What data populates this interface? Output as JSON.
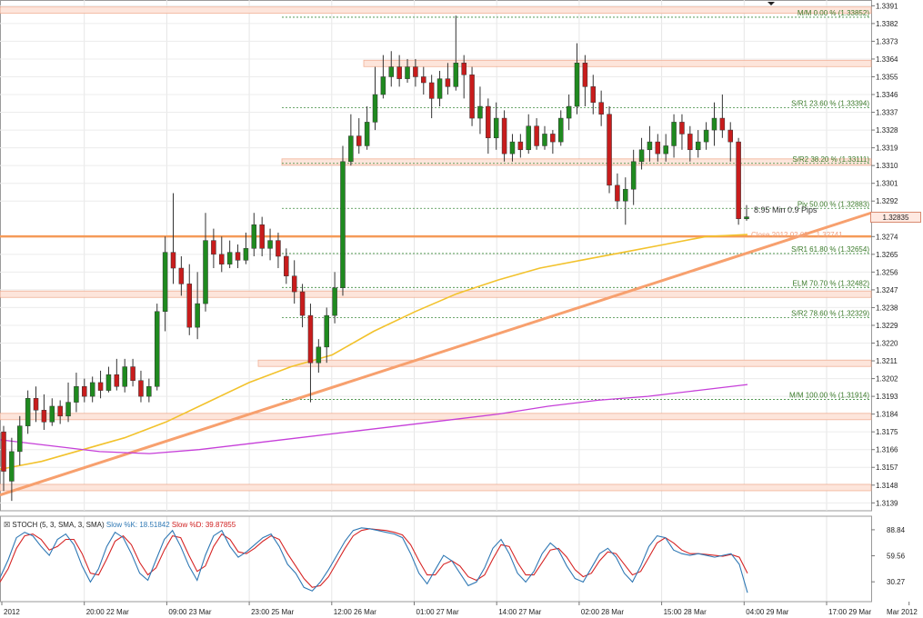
{
  "chart_data": {
    "type": "candlestick",
    "instrument_y_axis": {
      "ticks": [
        1.3391,
        1.3382,
        1.3373,
        1.3364,
        1.3355,
        1.3346,
        1.3337,
        1.3328,
        1.3319,
        1.331,
        1.3301,
        1.3292,
        1.3274,
        1.3265,
        1.3256,
        1.3247,
        1.3238,
        1.3229,
        1.322,
        1.3211,
        1.3202,
        1.3193,
        1.3184,
        1.3175,
        1.3166,
        1.3157,
        1.3148,
        1.3139
      ],
      "ylim": [
        1.3135,
        1.3393
      ]
    },
    "x_tick_labels": [
      "2012",
      "20:00 22 Mar",
      "09:00 23 Mar",
      "23:00 25 Mar",
      "12:00 26 Mar",
      "01:00 27 Mar",
      "14:00 27 Mar",
      "02:00 28 Mar",
      "15:00 28 Mar",
      "04:00 29 Mar",
      "17:00 29 Mar",
      "Mar 2012"
    ],
    "current_price": "1.32835",
    "measurement_label": "8.95 Min 0.9 Pips",
    "close_label": "Close 2012.02.09 .. 1.32741",
    "fib_levels": [
      {
        "label": "M/M 0.00 % (1.33852)",
        "price": 1.33852
      },
      {
        "label": "S/R1 23.60 % (1.33394)",
        "price": 1.33394
      },
      {
        "label": "S/R2 38.20 % (1.33111)",
        "price": 1.33111
      },
      {
        "label": "Piv 50.00 % (1.32883)",
        "price": 1.32883
      },
      {
        "label": "S/R1 61.80 % (1.32654)",
        "price": 1.32654
      },
      {
        "label": "ELM 70.70 % (1.32482)",
        "price": 1.32482
      },
      {
        "label": "S/R2 78.60 % (1.32329)",
        "price": 1.32329
      },
      {
        "label": "M/M 100.00 % (1.31914)",
        "price": 1.31914
      }
    ],
    "zones": [
      1.3389,
      1.3362,
      1.3312,
      1.3245,
      1.321,
      1.3183,
      1.3147
    ],
    "close_line": 1.32741,
    "trendline": {
      "start": 1.3143,
      "end": 1.3286
    },
    "sma_yellow": [
      1.3156,
      1.316,
      1.3166,
      1.3172,
      1.318,
      1.319,
      1.32,
      1.3208,
      1.3214,
      1.3226,
      1.3236,
      1.3245,
      1.3252,
      1.3258,
      1.3262,
      1.3266,
      1.327,
      1.3274,
      1.3275
    ],
    "sma_magenta": [
      1.3171,
      1.3168,
      1.3165,
      1.3164,
      1.3166,
      1.3169,
      1.3172,
      1.3175,
      1.3178,
      1.3181,
      1.3184,
      1.3188,
      1.3191,
      1.3193,
      1.3196,
      1.3199
    ],
    "candles": [
      [
        1.3175,
        1.3155,
        1.3178,
        1.3145
      ],
      [
        1.315,
        1.3165,
        1.3172,
        1.314
      ],
      [
        1.3165,
        1.3178,
        1.3183,
        1.3158
      ],
      [
        1.3178,
        1.3192,
        1.3196,
        1.3174
      ],
      [
        1.3192,
        1.3186,
        1.3198,
        1.318
      ],
      [
        1.3186,
        1.318,
        1.3194,
        1.3176
      ],
      [
        1.318,
        1.3188,
        1.3192,
        1.3178
      ],
      [
        1.3188,
        1.3183,
        1.3191,
        1.3179
      ],
      [
        1.3183,
        1.319,
        1.32,
        1.318
      ],
      [
        1.319,
        1.3198,
        1.3205,
        1.3185
      ],
      [
        1.3198,
        1.3193,
        1.3202,
        1.319
      ],
      [
        1.3193,
        1.32,
        1.3203,
        1.319
      ],
      [
        1.32,
        1.3196,
        1.3206,
        1.3192
      ],
      [
        1.3196,
        1.3204,
        1.3208,
        1.3195
      ],
      [
        1.3204,
        1.3198,
        1.3212,
        1.3196
      ],
      [
        1.3198,
        1.3208,
        1.3212,
        1.3195
      ],
      [
        1.3208,
        1.3201,
        1.3212,
        1.3198
      ],
      [
        1.3201,
        1.3193,
        1.3206,
        1.319
      ],
      [
        1.3193,
        1.3198,
        1.3202,
        1.319
      ],
      [
        1.3198,
        1.3236,
        1.324,
        1.3196
      ],
      [
        1.3236,
        1.3266,
        1.3274,
        1.3226
      ],
      [
        1.3266,
        1.3258,
        1.3296,
        1.325
      ],
      [
        1.3258,
        1.325,
        1.3264,
        1.3244
      ],
      [
        1.325,
        1.3228,
        1.326,
        1.3224
      ],
      [
        1.3228,
        1.324,
        1.3256,
        1.3222
      ],
      [
        1.324,
        1.3272,
        1.3286,
        1.3236
      ],
      [
        1.3272,
        1.3265,
        1.3278,
        1.3258
      ],
      [
        1.3265,
        1.326,
        1.3274,
        1.3256
      ],
      [
        1.326,
        1.3266,
        1.3272,
        1.3258
      ],
      [
        1.3266,
        1.3262,
        1.327,
        1.3258
      ],
      [
        1.3262,
        1.3268,
        1.3276,
        1.326
      ],
      [
        1.3268,
        1.328,
        1.3286,
        1.3264
      ],
      [
        1.328,
        1.3268,
        1.3284,
        1.3264
      ],
      [
        1.3268,
        1.3272,
        1.3278,
        1.3262
      ],
      [
        1.3272,
        1.3264,
        1.3276,
        1.3258
      ],
      [
        1.3264,
        1.3254,
        1.3268,
        1.325
      ],
      [
        1.3254,
        1.3246,
        1.3262,
        1.324
      ],
      [
        1.3246,
        1.3234,
        1.325,
        1.3228
      ],
      [
        1.3234,
        1.321,
        1.324,
        1.319
      ],
      [
        1.321,
        1.3218,
        1.3222,
        1.3205
      ],
      [
        1.3218,
        1.3234,
        1.3238,
        1.321
      ],
      [
        1.3234,
        1.3248,
        1.3256,
        1.323
      ],
      [
        1.3248,
        1.3312,
        1.332,
        1.3244
      ],
      [
        1.3312,
        1.3325,
        1.3336,
        1.331
      ],
      [
        1.3325,
        1.332,
        1.3334,
        1.3316
      ],
      [
        1.332,
        1.3332,
        1.334,
        1.3318
      ],
      [
        1.3332,
        1.3346,
        1.336,
        1.3328
      ],
      [
        1.3346,
        1.3355,
        1.3366,
        1.3344
      ],
      [
        1.3355,
        1.336,
        1.3368,
        1.335
      ],
      [
        1.336,
        1.3354,
        1.3366,
        1.335
      ],
      [
        1.3354,
        1.336,
        1.3364,
        1.3352
      ],
      [
        1.336,
        1.3355,
        1.3364,
        1.335
      ],
      [
        1.3355,
        1.3352,
        1.336,
        1.3346
      ],
      [
        1.3352,
        1.3344,
        1.3356,
        1.3334
      ],
      [
        1.3344,
        1.3354,
        1.3358,
        1.334
      ],
      [
        1.3354,
        1.335,
        1.3362,
        1.3346
      ],
      [
        1.335,
        1.3362,
        1.3386,
        1.3348
      ],
      [
        1.3362,
        1.3356,
        1.3366,
        1.3344
      ],
      [
        1.3356,
        1.3334,
        1.336,
        1.333
      ],
      [
        1.3334,
        1.334,
        1.335,
        1.3326
      ],
      [
        1.334,
        1.3324,
        1.3344,
        1.3316
      ],
      [
        1.3324,
        1.3334,
        1.3342,
        1.3318
      ],
      [
        1.3334,
        1.3316,
        1.3338,
        1.3312
      ],
      [
        1.3316,
        1.3322,
        1.3326,
        1.3312
      ],
      [
        1.3322,
        1.3318,
        1.3326,
        1.3314
      ],
      [
        1.3318,
        1.333,
        1.3336,
        1.3316
      ],
      [
        1.333,
        1.332,
        1.3334,
        1.3318
      ],
      [
        1.332,
        1.3326,
        1.333,
        1.3318
      ],
      [
        1.3326,
        1.3322,
        1.3328,
        1.3316
      ],
      [
        1.3322,
        1.3334,
        1.3338,
        1.332
      ],
      [
        1.3334,
        1.334,
        1.3346,
        1.3328
      ],
      [
        1.334,
        1.3362,
        1.3372,
        1.3336
      ],
      [
        1.3362,
        1.335,
        1.3366,
        1.334
      ],
      [
        1.335,
        1.3342,
        1.3356,
        1.3336
      ],
      [
        1.3342,
        1.3336,
        1.3348,
        1.333
      ],
      [
        1.3336,
        1.33,
        1.334,
        1.3296
      ],
      [
        1.33,
        1.3292,
        1.3306,
        1.3288
      ],
      [
        1.3292,
        1.3298,
        1.3304,
        1.328
      ],
      [
        1.3298,
        1.3312,
        1.3318,
        1.329
      ],
      [
        1.3312,
        1.3318,
        1.3324,
        1.3308
      ],
      [
        1.3318,
        1.3322,
        1.333,
        1.3312
      ],
      [
        1.3322,
        1.3316,
        1.3326,
        1.3312
      ],
      [
        1.3316,
        1.332,
        1.3326,
        1.3312
      ],
      [
        1.332,
        1.3332,
        1.3336,
        1.3314
      ],
      [
        1.3332,
        1.3326,
        1.3336,
        1.3318
      ],
      [
        1.3326,
        1.3318,
        1.333,
        1.3312
      ],
      [
        1.3318,
        1.3322,
        1.3328,
        1.3314
      ],
      [
        1.3322,
        1.3328,
        1.3332,
        1.3318
      ],
      [
        1.3328,
        1.3334,
        1.3342,
        1.332
      ],
      [
        1.3334,
        1.3328,
        1.3346,
        1.3324
      ],
      [
        1.3328,
        1.3322,
        1.3332,
        1.3312
      ],
      [
        1.3322,
        1.3283,
        1.3324,
        1.328
      ],
      [
        1.3283,
        1.3284,
        1.329,
        1.3282
      ]
    ],
    "stochastic": {
      "title_prefix": "STOCH (5, 3, SMA, 3, SMA)",
      "k_label": "Slow %K: 18.51842",
      "d_label": "Slow %D: 39.87855",
      "ticks": [
        88.84,
        59.56,
        30.27
      ],
      "k_values": [
        35,
        55,
        80,
        86,
        82,
        70,
        60,
        78,
        84,
        72,
        48,
        30,
        45,
        70,
        86,
        80,
        62,
        40,
        32,
        55,
        78,
        88,
        70,
        48,
        32,
        60,
        82,
        88,
        70,
        58,
        64,
        72,
        80,
        84,
        70,
        50,
        40,
        24,
        20,
        30,
        44,
        60,
        76,
        88,
        91,
        90,
        88,
        86,
        84,
        80,
        62,
        40,
        28,
        44,
        60,
        54,
        40,
        26,
        30,
        46,
        68,
        78,
        62,
        40,
        30,
        42,
        62,
        74,
        66,
        48,
        34,
        30,
        46,
        62,
        68,
        58,
        40,
        30,
        48,
        70,
        82,
        80,
        66,
        62,
        60,
        62,
        60,
        58,
        60,
        62,
        50,
        18
      ],
      "d_values": [
        30,
        45,
        68,
        82,
        84,
        78,
        66,
        70,
        78,
        78,
        62,
        40,
        38,
        56,
        76,
        82,
        72,
        52,
        38,
        46,
        66,
        82,
        80,
        60,
        42,
        48,
        70,
        84,
        78,
        64,
        62,
        68,
        76,
        82,
        78,
        62,
        48,
        34,
        24,
        26,
        36,
        52,
        68,
        82,
        88,
        90,
        89,
        88,
        86,
        83,
        72,
        54,
        38,
        38,
        50,
        54,
        48,
        36,
        32,
        38,
        56,
        72,
        70,
        52,
        38,
        38,
        52,
        66,
        68,
        58,
        44,
        36,
        40,
        54,
        64,
        62,
        50,
        38,
        42,
        58,
        74,
        80,
        74,
        66,
        62,
        62,
        61,
        60,
        59,
        61,
        58,
        40
      ]
    }
  }
}
